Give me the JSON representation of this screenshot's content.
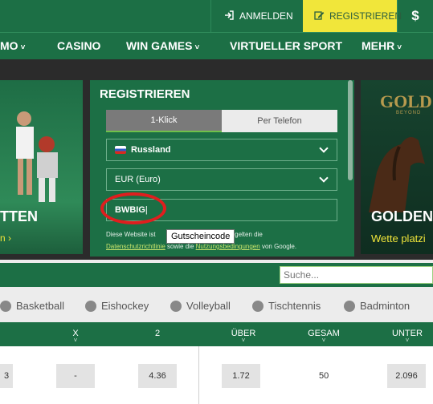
{
  "topbar": {
    "login": "ANMELDEN",
    "register": "REGISTRIEREN",
    "currency": "$"
  },
  "nav": [
    "MO",
    "CASINO",
    "WIN GAMES",
    "VIRTUELLER SPORT",
    "MEHR"
  ],
  "banner_left": {
    "title": "TTEN",
    "subtitle": "n ›"
  },
  "banner_right": {
    "logo": "GOLD",
    "logo_sub": "BEYOND",
    "title": "GOLDEN",
    "subtitle": "Wette platzi"
  },
  "register_panel": {
    "title": "REGISTRIEREN",
    "tabs": [
      "1-Klick",
      "Per Telefon"
    ],
    "country": "Russland",
    "currency": "EUR (Euro)",
    "coupon_value": "BWBIG",
    "disclaimer_prefix": "Diese Website ist",
    "disclaimer_mid": "tützt; es gelten die",
    "privacy_link": "Datenschutzrichtlinie",
    "and_text": "sowie die",
    "terms_link": "Nutzungsbedingungen",
    "google_text": "von Google.",
    "tooltip": "Gutscheincode"
  },
  "search": {
    "placeholder": "Suche..."
  },
  "sports": [
    "Basketball",
    "Eishockey",
    "Volleyball",
    "Tischtennis",
    "Badminton"
  ],
  "table_headers": [
    "X",
    "2",
    "ÜBER",
    "GESAM",
    "UNTER"
  ],
  "odds_row": {
    "first": "3",
    "x": "-",
    "two": "4.36",
    "over": "1.72",
    "total": "50",
    "under": "2.096"
  },
  "colors": {
    "brand_green": "#1c6f45",
    "accent_yellow": "#f1e63a",
    "highlight_red": "#e01e1e"
  }
}
